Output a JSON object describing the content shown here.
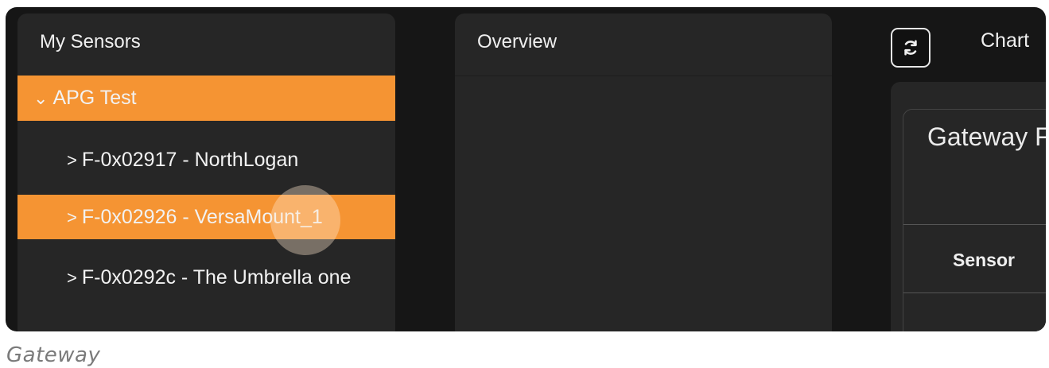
{
  "sensors_panel": {
    "title": "My Sensors",
    "group": {
      "label": "APG Test",
      "chevron": "⌄"
    },
    "items": [
      {
        "label": "F-0x02917 - NorthLogan",
        "chevron": ">"
      },
      {
        "label": "F-0x02926 - VersaMount_1",
        "chevron": ">"
      },
      {
        "label": "F-0x0292c - The Umbrella one",
        "chevron": ">"
      }
    ]
  },
  "overview_panel": {
    "title": "Overview"
  },
  "toolbar": {
    "refresh_icon": "refresh-icon",
    "chart_label": "Chart"
  },
  "gateway_card": {
    "title": "Gateway F",
    "column_header": "Sensor"
  },
  "caption": "Gateway",
  "colors": {
    "accent": "#f59433",
    "panel": "#262626",
    "background": "#161616"
  }
}
